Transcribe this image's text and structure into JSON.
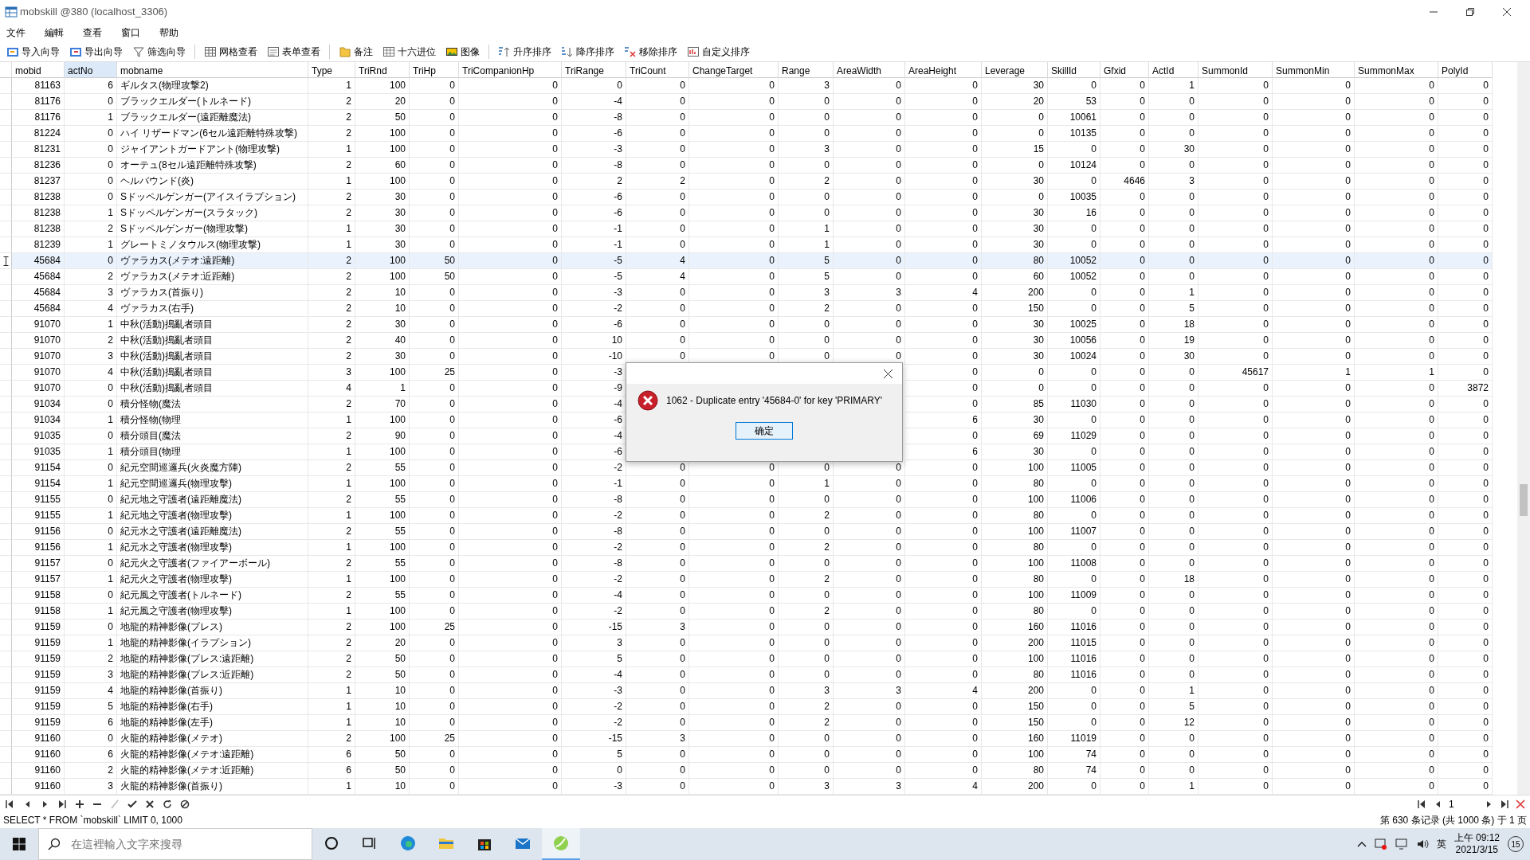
{
  "window": {
    "title": "mobskill @380 (localhost_3306)"
  },
  "menu": [
    "文件",
    "編輯",
    "查看",
    "窗口",
    "帮助"
  ],
  "toolbar": [
    {
      "label": "导入向导",
      "kind": "import"
    },
    {
      "label": "导出向导",
      "kind": "export"
    },
    {
      "label": "筛选向导",
      "kind": "filter"
    },
    {
      "label": "网格查看",
      "kind": "grid"
    },
    {
      "label": "表单查看",
      "kind": "form"
    },
    {
      "label": "备注",
      "kind": "note"
    },
    {
      "label": "十六进位",
      "kind": "hex"
    },
    {
      "label": "图像",
      "kind": "image"
    },
    {
      "label": "升序排序",
      "kind": "asc"
    },
    {
      "label": "降序排序",
      "kind": "desc"
    },
    {
      "label": "移除排序",
      "kind": "remove"
    },
    {
      "label": "自定义排序",
      "kind": "custom"
    }
  ],
  "table": {
    "columns": [
      {
        "label": "mobid",
        "selected": false
      },
      {
        "label": "actNo",
        "selected": true
      },
      {
        "label": "mobname",
        "selected": false
      },
      {
        "label": "Type",
        "selected": false
      },
      {
        "label": "TriRnd",
        "selected": false
      },
      {
        "label": "TriHp",
        "selected": false
      },
      {
        "label": "TriCompanionHp",
        "selected": false
      },
      {
        "label": "TriRange",
        "selected": false
      },
      {
        "label": "TriCount",
        "selected": false
      },
      {
        "label": "ChangeTarget",
        "selected": false
      },
      {
        "label": "Range",
        "selected": false
      },
      {
        "label": "AreaWidth",
        "selected": false
      },
      {
        "label": "AreaHeight",
        "selected": false
      },
      {
        "label": "Leverage",
        "selected": false
      },
      {
        "label": "SkillId",
        "selected": false
      },
      {
        "label": "Gfxid",
        "selected": false
      },
      {
        "label": "ActId",
        "selected": false
      },
      {
        "label": "SummonId",
        "selected": false
      },
      {
        "label": "SummonMin",
        "selected": false
      },
      {
        "label": "SummonMax",
        "selected": false
      },
      {
        "label": "PolyId",
        "selected": false
      }
    ],
    "rows": [
      {
        "selected": false,
        "cells": [
          "81163",
          "6",
          "ギルタス(物理攻撃2)",
          "1",
          "100",
          "0",
          "0",
          "0",
          "0",
          "0",
          "3",
          "0",
          "0",
          "30",
          "0",
          "0",
          "1",
          "0",
          "0",
          "0",
          "0"
        ]
      },
      {
        "selected": false,
        "cells": [
          "81176",
          "0",
          "ブラックエルダー(トルネード)",
          "2",
          "20",
          "0",
          "0",
          "-4",
          "0",
          "0",
          "0",
          "0",
          "0",
          "20",
          "53",
          "0",
          "0",
          "0",
          "0",
          "0",
          "0"
        ]
      },
      {
        "selected": false,
        "cells": [
          "81176",
          "1",
          "ブラックエルダー(遠距離魔法)",
          "2",
          "50",
          "0",
          "0",
          "-8",
          "0",
          "0",
          "0",
          "0",
          "0",
          "0",
          "10061",
          "0",
          "0",
          "0",
          "0",
          "0",
          "0"
        ]
      },
      {
        "selected": false,
        "cells": [
          "81224",
          "0",
          "ハイ リザードマン(6セル遠距離特殊攻撃)",
          "2",
          "100",
          "0",
          "0",
          "-6",
          "0",
          "0",
          "0",
          "0",
          "0",
          "0",
          "10135",
          "0",
          "0",
          "0",
          "0",
          "0",
          "0"
        ]
      },
      {
        "selected": false,
        "cells": [
          "81231",
          "0",
          "ジャイアントガードアント(物理攻撃)",
          "1",
          "100",
          "0",
          "0",
          "-3",
          "0",
          "0",
          "3",
          "0",
          "0",
          "15",
          "0",
          "0",
          "30",
          "0",
          "0",
          "0",
          "0"
        ]
      },
      {
        "selected": false,
        "cells": [
          "81236",
          "0",
          "オーテュ(8セル遠距離特殊攻撃)",
          "2",
          "60",
          "0",
          "0",
          "-8",
          "0",
          "0",
          "0",
          "0",
          "0",
          "0",
          "10124",
          "0",
          "0",
          "0",
          "0",
          "0",
          "0"
        ]
      },
      {
        "selected": false,
        "cells": [
          "81237",
          "0",
          "ヘルバウンド(炎)",
          "1",
          "100",
          "0",
          "0",
          "2",
          "2",
          "0",
          "2",
          "0",
          "0",
          "30",
          "0",
          "4646",
          "3",
          "0",
          "0",
          "0",
          "0"
        ]
      },
      {
        "selected": false,
        "cells": [
          "81238",
          "0",
          "Sドッペルゲンガー(アイスイラプション)",
          "2",
          "30",
          "0",
          "0",
          "-6",
          "0",
          "0",
          "0",
          "0",
          "0",
          "0",
          "10035",
          "0",
          "0",
          "0",
          "0",
          "0",
          "0"
        ]
      },
      {
        "selected": false,
        "cells": [
          "81238",
          "1",
          "Sドッペルゲンガー(スラタック)",
          "2",
          "30",
          "0",
          "0",
          "-6",
          "0",
          "0",
          "0",
          "0",
          "0",
          "30",
          "16",
          "0",
          "0",
          "0",
          "0",
          "0",
          "0"
        ]
      },
      {
        "selected": false,
        "cells": [
          "81238",
          "2",
          "Sドッペルゲンガー(物理攻撃)",
          "1",
          "30",
          "0",
          "0",
          "-1",
          "0",
          "0",
          "1",
          "0",
          "0",
          "30",
          "0",
          "0",
          "0",
          "0",
          "0",
          "0",
          "0"
        ]
      },
      {
        "selected": false,
        "cells": [
          "81239",
          "1",
          "グレートミノタウルス(物理攻撃)",
          "1",
          "30",
          "0",
          "0",
          "-1",
          "0",
          "0",
          "1",
          "0",
          "0",
          "30",
          "0",
          "0",
          "0",
          "0",
          "0",
          "0",
          "0"
        ]
      },
      {
        "selected": true,
        "cells": [
          "45684",
          "0",
          "ヴァラカス(メテオ:遠距離)",
          "2",
          "100",
          "50",
          "0",
          "-5",
          "4",
          "0",
          "5",
          "0",
          "0",
          "80",
          "10052",
          "0",
          "0",
          "0",
          "0",
          "0",
          "0"
        ]
      },
      {
        "selected": false,
        "cells": [
          "45684",
          "2",
          "ヴァラカス(メテオ:近距離)",
          "2",
          "100",
          "50",
          "0",
          "-5",
          "4",
          "0",
          "5",
          "0",
          "0",
          "60",
          "10052",
          "0",
          "0",
          "0",
          "0",
          "0",
          "0"
        ]
      },
      {
        "selected": false,
        "cells": [
          "45684",
          "3",
          "ヴァラカス(首振り)",
          "2",
          "10",
          "0",
          "0",
          "-3",
          "0",
          "0",
          "3",
          "3",
          "4",
          "200",
          "0",
          "0",
          "1",
          "0",
          "0",
          "0",
          "0"
        ]
      },
      {
        "selected": false,
        "cells": [
          "45684",
          "4",
          "ヴァラカス(右手)",
          "2",
          "10",
          "0",
          "0",
          "-2",
          "0",
          "0",
          "2",
          "0",
          "0",
          "150",
          "0",
          "0",
          "5",
          "0",
          "0",
          "0",
          "0"
        ]
      },
      {
        "selected": false,
        "cells": [
          "91070",
          "1",
          "中秋(活動)搗亂者頭目",
          "2",
          "30",
          "0",
          "0",
          "-6",
          "0",
          "0",
          "0",
          "0",
          "0",
          "30",
          "10025",
          "0",
          "18",
          "0",
          "0",
          "0",
          "0"
        ]
      },
      {
        "selected": false,
        "cells": [
          "91070",
          "2",
          "中秋(活動)搗亂者頭目",
          "2",
          "40",
          "0",
          "0",
          "10",
          "0",
          "0",
          "0",
          "0",
          "0",
          "30",
          "10056",
          "0",
          "19",
          "0",
          "0",
          "0",
          "0"
        ]
      },
      {
        "selected": false,
        "cells": [
          "91070",
          "3",
          "中秋(活動)搗亂者頭目",
          "2",
          "30",
          "0",
          "0",
          "-10",
          "0",
          "0",
          "0",
          "0",
          "0",
          "30",
          "10024",
          "0",
          "30",
          "0",
          "0",
          "0",
          "0"
        ]
      },
      {
        "selected": false,
        "cells": [
          "91070",
          "4",
          "中秋(活動)搗亂者頭目",
          "3",
          "100",
          "25",
          "0",
          "-3",
          null,
          null,
          null,
          null,
          "0",
          "0",
          "0",
          "0",
          "0",
          "45617",
          "1",
          "1",
          "0"
        ]
      },
      {
        "selected": false,
        "cells": [
          "91070",
          "0",
          "中秋(活動)搗亂者頭目",
          "4",
          "1",
          "0",
          "0",
          "-9",
          null,
          null,
          null,
          null,
          "0",
          "0",
          "0",
          "0",
          "0",
          "0",
          "0",
          "0",
          "3872"
        ]
      },
      {
        "selected": false,
        "cells": [
          "91034",
          "0",
          "積分怪物(魔法",
          "2",
          "70",
          "0",
          "0",
          "-4",
          null,
          null,
          null,
          null,
          "0",
          "85",
          "11030",
          "0",
          "0",
          "0",
          "0",
          "0",
          "0"
        ]
      },
      {
        "selected": false,
        "cells": [
          "91034",
          "1",
          "積分怪物(物理",
          "1",
          "100",
          "0",
          "0",
          "-6",
          null,
          null,
          null,
          null,
          "6",
          "30",
          "0",
          "0",
          "0",
          "0",
          "0",
          "0",
          "0"
        ]
      },
      {
        "selected": false,
        "cells": [
          "91035",
          "0",
          "積分頭目(魔法",
          "2",
          "90",
          "0",
          "0",
          "-4",
          null,
          null,
          null,
          null,
          "0",
          "69",
          "11029",
          "0",
          "0",
          "0",
          "0",
          "0",
          "0"
        ]
      },
      {
        "selected": false,
        "cells": [
          "91035",
          "1",
          "積分頭目(物理",
          "1",
          "100",
          "0",
          "0",
          "-6",
          null,
          null,
          null,
          null,
          "6",
          "30",
          "0",
          "0",
          "0",
          "0",
          "0",
          "0",
          "0"
        ]
      },
      {
        "selected": false,
        "cells": [
          "91154",
          "0",
          "紀元空間巡邏兵(火炎魔方陣)",
          "2",
          "55",
          "0",
          "0",
          "-2",
          "0",
          "0",
          "0",
          "0",
          "0",
          "100",
          "11005",
          "0",
          "0",
          "0",
          "0",
          "0",
          "0"
        ]
      },
      {
        "selected": false,
        "cells": [
          "91154",
          "1",
          "紀元空間巡邏兵(物理攻擊)",
          "1",
          "100",
          "0",
          "0",
          "-1",
          "0",
          "0",
          "1",
          "0",
          "0",
          "80",
          "0",
          "0",
          "0",
          "0",
          "0",
          "0",
          "0"
        ]
      },
      {
        "selected": false,
        "cells": [
          "91155",
          "0",
          "紀元地之守護者(遠距離魔法)",
          "2",
          "55",
          "0",
          "0",
          "-8",
          "0",
          "0",
          "0",
          "0",
          "0",
          "100",
          "11006",
          "0",
          "0",
          "0",
          "0",
          "0",
          "0"
        ]
      },
      {
        "selected": false,
        "cells": [
          "91155",
          "1",
          "紀元地之守護者(物理攻擊)",
          "1",
          "100",
          "0",
          "0",
          "-2",
          "0",
          "0",
          "2",
          "0",
          "0",
          "80",
          "0",
          "0",
          "0",
          "0",
          "0",
          "0",
          "0"
        ]
      },
      {
        "selected": false,
        "cells": [
          "91156",
          "0",
          "紀元水之守護者(遠距離魔法)",
          "2",
          "55",
          "0",
          "0",
          "-8",
          "0",
          "0",
          "0",
          "0",
          "0",
          "100",
          "11007",
          "0",
          "0",
          "0",
          "0",
          "0",
          "0"
        ]
      },
      {
        "selected": false,
        "cells": [
          "91156",
          "1",
          "紀元水之守護者(物理攻擊)",
          "1",
          "100",
          "0",
          "0",
          "-2",
          "0",
          "0",
          "2",
          "0",
          "0",
          "80",
          "0",
          "0",
          "0",
          "0",
          "0",
          "0",
          "0"
        ]
      },
      {
        "selected": false,
        "cells": [
          "91157",
          "0",
          "紀元火之守護者(ファイアーボール)",
          "2",
          "55",
          "0",
          "0",
          "-8",
          "0",
          "0",
          "0",
          "0",
          "0",
          "100",
          "11008",
          "0",
          "0",
          "0",
          "0",
          "0",
          "0"
        ]
      },
      {
        "selected": false,
        "cells": [
          "91157",
          "1",
          "紀元火之守護者(物理攻擊)",
          "1",
          "100",
          "0",
          "0",
          "-2",
          "0",
          "0",
          "2",
          "0",
          "0",
          "80",
          "0",
          "0",
          "18",
          "0",
          "0",
          "0",
          "0"
        ]
      },
      {
        "selected": false,
        "cells": [
          "91158",
          "0",
          "紀元風之守護者(トルネード)",
          "2",
          "55",
          "0",
          "0",
          "-4",
          "0",
          "0",
          "0",
          "0",
          "0",
          "100",
          "11009",
          "0",
          "0",
          "0",
          "0",
          "0",
          "0"
        ]
      },
      {
        "selected": false,
        "cells": [
          "91158",
          "1",
          "紀元風之守護者(物理攻擊)",
          "1",
          "100",
          "0",
          "0",
          "-2",
          "0",
          "0",
          "2",
          "0",
          "0",
          "80",
          "0",
          "0",
          "0",
          "0",
          "0",
          "0",
          "0"
        ]
      },
      {
        "selected": false,
        "cells": [
          "91159",
          "0",
          "地龍的精神影像(ブレス)",
          "2",
          "100",
          "25",
          "0",
          "-15",
          "3",
          "0",
          "0",
          "0",
          "0",
          "160",
          "11016",
          "0",
          "0",
          "0",
          "0",
          "0",
          "0"
        ]
      },
      {
        "selected": false,
        "cells": [
          "91159",
          "1",
          "地龍的精神影像(イラプション)",
          "2",
          "20",
          "0",
          "0",
          "3",
          "0",
          "0",
          "0",
          "0",
          "0",
          "200",
          "11015",
          "0",
          "0",
          "0",
          "0",
          "0",
          "0"
        ]
      },
      {
        "selected": false,
        "cells": [
          "91159",
          "2",
          "地龍的精神影像(ブレス:遠距離)",
          "2",
          "50",
          "0",
          "0",
          "5",
          "0",
          "0",
          "0",
          "0",
          "0",
          "100",
          "11016",
          "0",
          "0",
          "0",
          "0",
          "0",
          "0"
        ]
      },
      {
        "selected": false,
        "cells": [
          "91159",
          "3",
          "地龍的精神影像(ブレス:近距離)",
          "2",
          "50",
          "0",
          "0",
          "-4",
          "0",
          "0",
          "0",
          "0",
          "0",
          "80",
          "11016",
          "0",
          "0",
          "0",
          "0",
          "0",
          "0"
        ]
      },
      {
        "selected": false,
        "cells": [
          "91159",
          "4",
          "地龍的精神影像(首振り)",
          "1",
          "10",
          "0",
          "0",
          "-3",
          "0",
          "0",
          "3",
          "3",
          "4",
          "200",
          "0",
          "0",
          "1",
          "0",
          "0",
          "0",
          "0"
        ]
      },
      {
        "selected": false,
        "cells": [
          "91159",
          "5",
          "地龍的精神影像(右手)",
          "1",
          "10",
          "0",
          "0",
          "-2",
          "0",
          "0",
          "2",
          "0",
          "0",
          "150",
          "0",
          "0",
          "5",
          "0",
          "0",
          "0",
          "0"
        ]
      },
      {
        "selected": false,
        "cells": [
          "91159",
          "6",
          "地龍的精神影像(左手)",
          "1",
          "10",
          "0",
          "0",
          "-2",
          "0",
          "0",
          "2",
          "0",
          "0",
          "150",
          "0",
          "0",
          "12",
          "0",
          "0",
          "0",
          "0"
        ]
      },
      {
        "selected": false,
        "cells": [
          "91160",
          "0",
          "火龍的精神影像(メテオ)",
          "2",
          "100",
          "25",
          "0",
          "-15",
          "3",
          "0",
          "0",
          "0",
          "0",
          "160",
          "11019",
          "0",
          "0",
          "0",
          "0",
          "0",
          "0"
        ]
      },
      {
        "selected": false,
        "cells": [
          "91160",
          "6",
          "火龍的精神影像(メテオ:遠距離)",
          "6",
          "50",
          "0",
          "0",
          "5",
          "0",
          "0",
          "0",
          "0",
          "0",
          "100",
          "74",
          "0",
          "0",
          "0",
          "0",
          "0",
          "0"
        ]
      },
      {
        "selected": false,
        "cells": [
          "91160",
          "2",
          "火龍的精神影像(メテオ:近距離)",
          "6",
          "50",
          "0",
          "0",
          "0",
          "0",
          "0",
          "0",
          "0",
          "0",
          "80",
          "74",
          "0",
          "0",
          "0",
          "0",
          "0",
          "0"
        ]
      },
      {
        "selected": false,
        "cells": [
          "91160",
          "3",
          "火龍的精神影像(首振り)",
          "1",
          "10",
          "0",
          "0",
          "-3",
          "0",
          "0",
          "3",
          "3",
          "4",
          "200",
          "0",
          "0",
          "1",
          "0",
          "0",
          "0",
          "0"
        ]
      }
    ]
  },
  "dialog": {
    "message": "1062 - Duplicate entry '45684-0' for key 'PRIMARY'",
    "button": "确定"
  },
  "record_nav": [
    {
      "kind": "first",
      "disabled": false
    },
    {
      "kind": "prev",
      "disabled": false
    },
    {
      "kind": "next",
      "disabled": false
    },
    {
      "kind": "last",
      "disabled": false
    },
    {
      "kind": "add",
      "disabled": false
    },
    {
      "kind": "delete",
      "disabled": false
    },
    {
      "kind": "edit",
      "disabled": true
    },
    {
      "kind": "apply",
      "disabled": false
    },
    {
      "kind": "cancel",
      "disabled": false
    },
    {
      "kind": "refresh",
      "disabled": false
    },
    {
      "kind": "stop",
      "disabled": false
    }
  ],
  "pager": {
    "page": "1"
  },
  "status_bar": {
    "query": "SELECT * FROM `mobskill` LIMIT 0, 1000",
    "records": "第 630 条记录 (共 1000 条) 于 1 页"
  },
  "taskbar": {
    "search_placeholder": "在這裡輸入文字來搜尋",
    "apps": [
      {
        "kind": "cortana",
        "selected": false
      },
      {
        "kind": "taskview",
        "selected": false
      },
      {
        "kind": "edge",
        "selected": false
      },
      {
        "kind": "explorer",
        "selected": false
      },
      {
        "kind": "store",
        "selected": false
      },
      {
        "kind": "mail",
        "selected": false
      },
      {
        "kind": "navicat",
        "selected": true
      }
    ],
    "ime": "英",
    "time": "上午 09:12",
    "date": "2021/3/15",
    "notifications": "15"
  }
}
